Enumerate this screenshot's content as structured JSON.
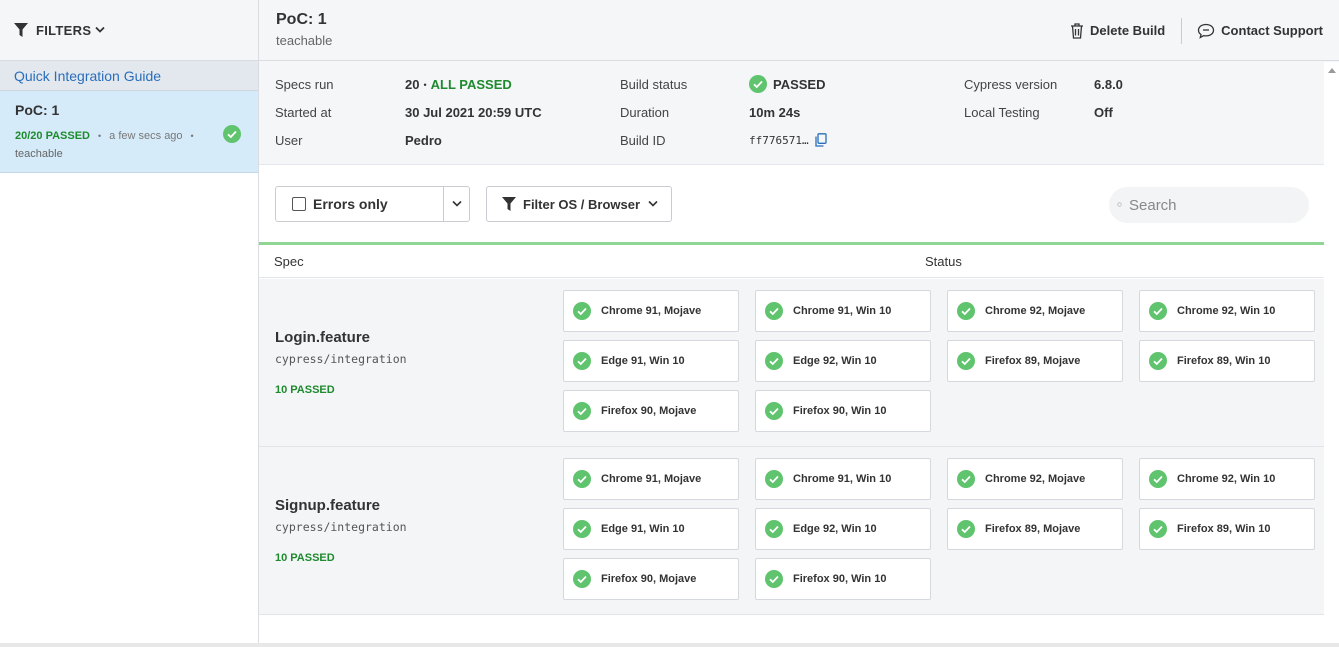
{
  "sidebar": {
    "filters_label": "FILTERS",
    "quick_guide": "Quick Integration Guide",
    "run": {
      "title": "PoC: 1",
      "passed": "20/20 PASSED",
      "time": "a few secs ago",
      "project": "teachable"
    }
  },
  "header": {
    "title": "PoC: 1",
    "subtitle": "teachable",
    "delete_build": "Delete Build",
    "contact_support": "Contact Support"
  },
  "info": {
    "specs_run_label": "Specs run",
    "specs_run_count": "20",
    "specs_run_status": "ALL PASSED",
    "started_at_label": "Started at",
    "started_at": "30 Jul 2021 20:59 UTC",
    "user_label": "User",
    "user": "Pedro",
    "build_status_label": "Build status",
    "build_status": "PASSED",
    "duration_label": "Duration",
    "duration": "10m 24s",
    "build_id_label": "Build ID",
    "build_id": "ff776571…",
    "cypress_version_label": "Cypress version",
    "cypress_version": "6.8.0",
    "local_testing_label": "Local Testing",
    "local_testing": "Off"
  },
  "toolbar": {
    "errors_only": "Errors only",
    "filter_os": "Filter OS / Browser",
    "search_placeholder": "Search"
  },
  "table": {
    "col_spec": "Spec",
    "col_status": "Status"
  },
  "specs": [
    {
      "name": "Login.feature",
      "path": "cypress/integration",
      "count": "10 PASSED",
      "results": [
        "Chrome 91, Mojave",
        "Chrome 91, Win 10",
        "Chrome 92, Mojave",
        "Chrome 92, Win 10",
        "Edge 91, Win 10",
        "Edge 92, Win 10",
        "Firefox 89, Mojave",
        "Firefox 89, Win 10",
        "Firefox 90, Mojave",
        "Firefox 90, Win 10"
      ]
    },
    {
      "name": "Signup.feature",
      "path": "cypress/integration",
      "count": "10 PASSED",
      "results": [
        "Chrome 91, Mojave",
        "Chrome 91, Win 10",
        "Chrome 92, Mojave",
        "Chrome 92, Win 10",
        "Edge 91, Win 10",
        "Edge 92, Win 10",
        "Firefox 89, Mojave",
        "Firefox 89, Win 10",
        "Firefox 90, Mojave",
        "Firefox 90, Win 10"
      ]
    }
  ],
  "colors": {
    "pass_green": "#1e8a2e",
    "check_green": "#5fc46d",
    "link_blue": "#2a6ebb"
  }
}
